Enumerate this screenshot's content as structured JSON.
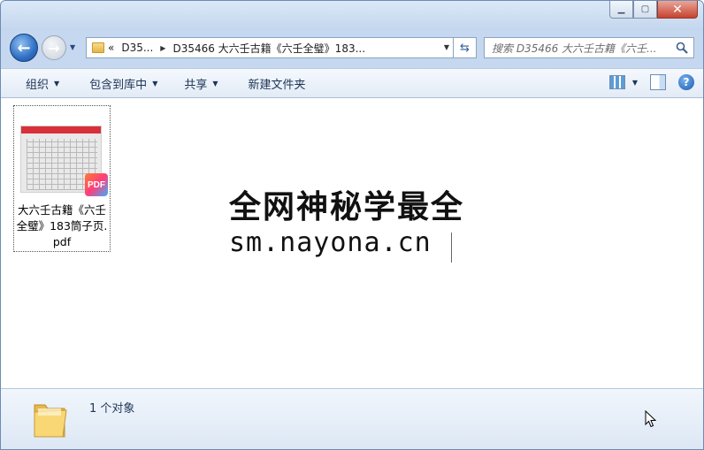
{
  "address": {
    "crumbs": [
      "D35...",
      "D35466 大六壬古籍《六壬全璧》183..."
    ],
    "overflow": "«"
  },
  "search": {
    "placeholder": "搜索 D35466 大六壬古籍《六壬..."
  },
  "toolbar": {
    "organize": "组织",
    "include_library": "包含到库中",
    "share": "共享",
    "new_folder": "新建文件夹"
  },
  "file": {
    "name": "大六壬古籍《六壬全璧》183筒子页.pdf",
    "badge": "PDF",
    "thumb_label": "PDF"
  },
  "watermark": {
    "line1": "全网神秘学最全",
    "line2": "sm.nayona.cn"
  },
  "status": {
    "count": "1 个对象"
  },
  "colors": {
    "accent": "#2f6fc4",
    "close": "#c7422f",
    "pdf_badge": "#ff3e7a"
  }
}
